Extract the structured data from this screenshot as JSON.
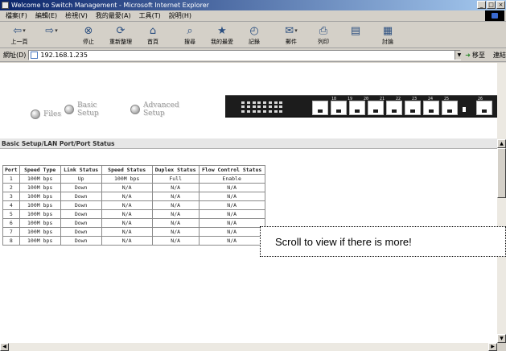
{
  "window": {
    "title": "Welcome to Switch Management - Microsoft Internet Explorer",
    "controls": [
      "_",
      "□",
      "×"
    ]
  },
  "menu": {
    "items": [
      "檔案(F)",
      "編輯(E)",
      "檢視(V)",
      "我的最愛(A)",
      "工具(T)",
      "說明(H)"
    ]
  },
  "toolbar": {
    "back_label": "上一頁",
    "forward_label": "",
    "stop_label": "停止",
    "refresh_label": "重新整理",
    "home_label": "首頁",
    "search_label": "搜尋",
    "favorites_label": "我的最愛",
    "history_label": "記錄",
    "mail_label": "郵件",
    "print_label": "列印",
    "discuss_label": "討論"
  },
  "address": {
    "label": "網址(D)",
    "value": "192.168.1.235",
    "go_label": "移至",
    "links_label": "連結"
  },
  "page": {
    "nav": {
      "files": "Files",
      "basic_setup": "Basic Setup",
      "advanced_setup": "Advanced Setup"
    },
    "switch_port_numbers": [
      "18",
      "19",
      "20",
      "21",
      "22",
      "23",
      "24",
      "25",
      "26"
    ],
    "section_title": "Basic Setup/LAN Port/Port Status",
    "table": {
      "columns": [
        "Port",
        "Speed Type",
        "Link Status",
        "Speed Status",
        "Duplex Status",
        "Flow Control Status"
      ],
      "rows": [
        [
          "1",
          "100M bps",
          "Up",
          "100M bps",
          "Full",
          "Enable"
        ],
        [
          "2",
          "100M bps",
          "Down",
          "N/A",
          "N/A",
          "N/A"
        ],
        [
          "3",
          "100M bps",
          "Down",
          "N/A",
          "N/A",
          "N/A"
        ],
        [
          "4",
          "100M bps",
          "Down",
          "N/A",
          "N/A",
          "N/A"
        ],
        [
          "5",
          "100M bps",
          "Down",
          "N/A",
          "N/A",
          "N/A"
        ],
        [
          "6",
          "100M bps",
          "Down",
          "N/A",
          "N/A",
          "N/A"
        ],
        [
          "7",
          "100M bps",
          "Down",
          "N/A",
          "N/A",
          "N/A"
        ],
        [
          "8",
          "100M bps",
          "Down",
          "N/A",
          "N/A",
          "N/A"
        ]
      ]
    },
    "callout": "Scroll to view if there is more!"
  },
  "colors": {
    "titlebar_start": "#0a246a",
    "titlebar_end": "#a6caf0",
    "chrome": "#d4d0c8",
    "switch_panel": "#1c1c1c"
  }
}
